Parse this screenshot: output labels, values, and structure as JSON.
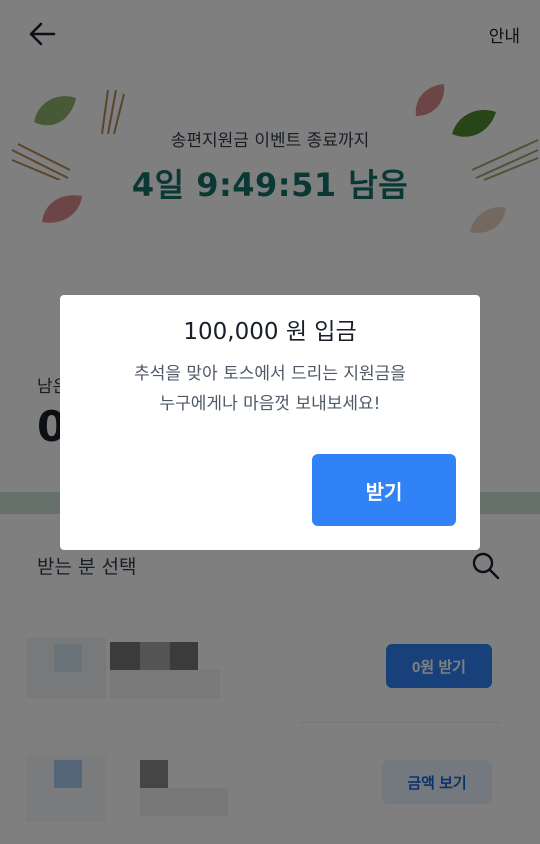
{
  "header": {
    "guide_label": "안내"
  },
  "event": {
    "countdown_label": "송편지원금 이벤트 종료까지",
    "countdown_value": "4일 9:49:51 남음"
  },
  "balance": {
    "label": "남은",
    "value": "0"
  },
  "recipients": {
    "section_label": "받는 분 선택",
    "rows": [
      {
        "action_label": "0원 받기"
      },
      {
        "action_label": "금액 보기"
      }
    ]
  },
  "dialog": {
    "title": "100,000 원 입금",
    "body_line1": "추석을 맞아 토스에서 드리는 지원금을",
    "body_line2": "누구에게나 마음껏 보내보세요!",
    "confirm_label": "받기"
  },
  "colors": {
    "accent_blue": "#3182f6",
    "countdown_teal": "#14716a",
    "overlay": "rgba(0,0,0,0.5)"
  },
  "icons": [
    "back-arrow-icon",
    "search-icon",
    "leaf-icon",
    "pine-needle-icon"
  ]
}
